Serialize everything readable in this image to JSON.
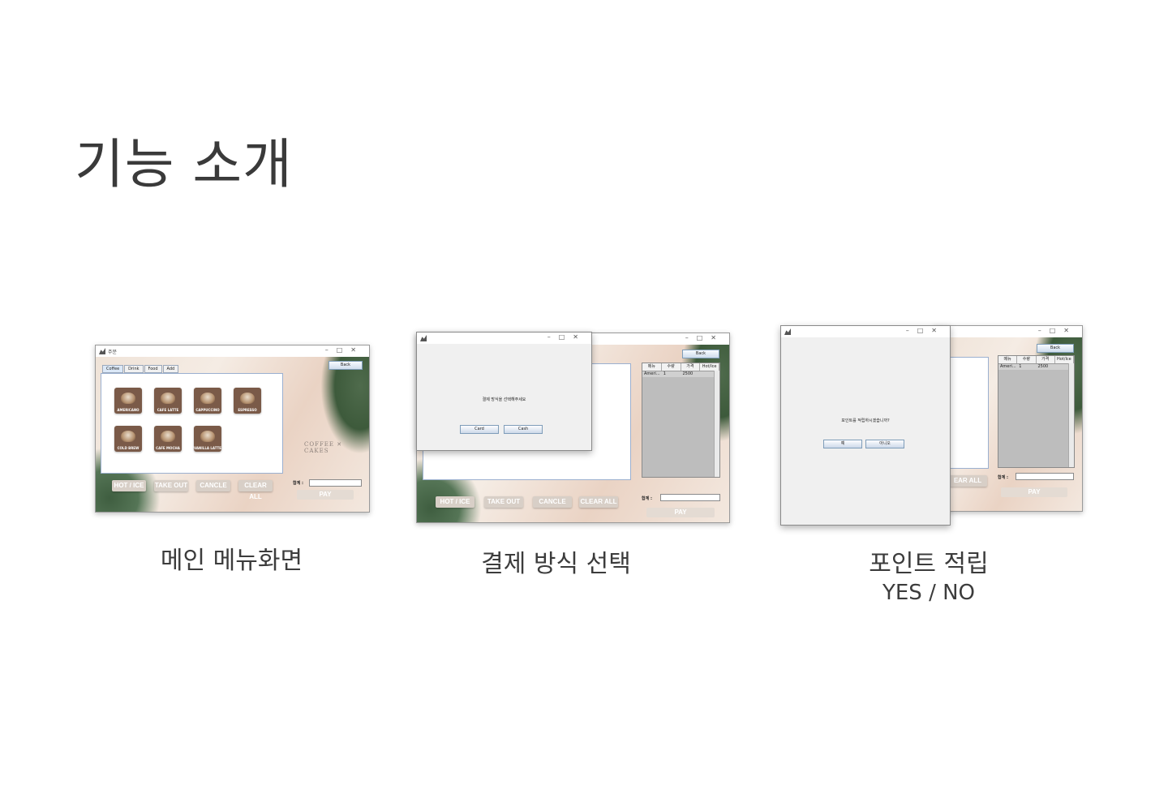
{
  "slide": {
    "title": "기능 소개"
  },
  "screens": [
    {
      "caption": "메인 메뉴화면",
      "window_title": "주문",
      "tabs": [
        "Coffee",
        "Drink",
        "Food",
        "Add"
      ],
      "back_label": "Back",
      "products": [
        "AMERICANO",
        "CAFE LATTE",
        "CAPPUCCINO",
        "ESPRESSO",
        "COLD BREW",
        "CAFE MOCHA",
        "VANILLA LATTE"
      ],
      "actions": [
        "HOT / ICE",
        "TAKE OUT",
        "CANCLE",
        "CLEAR ALL"
      ],
      "sum_label": "합계 :",
      "pay_label": "PAY",
      "logo": "COFFEE ✕ CAKES"
    },
    {
      "caption": "결제 방식 선택",
      "back_label": "Back",
      "table_headers": [
        "메뉴",
        "수량",
        "가격",
        "Hot/Ice"
      ],
      "table_row": [
        "Ameri...",
        "1",
        "2500",
        ""
      ],
      "actions": [
        "HOT / ICE",
        "TAKE OUT",
        "CANCLE",
        "CLEAR ALL"
      ],
      "sum_label": "합계 :",
      "pay_label": "PAY",
      "dialog_message": "결제 방식을 선택해주세요",
      "dialog_buttons": [
        "Card",
        "Cash"
      ]
    },
    {
      "caption": "포인트 적립",
      "caption_sub": "YES / NO",
      "back_label": "Back",
      "table_headers": [
        "메뉴",
        "수량",
        "가격",
        "Hot/Ice"
      ],
      "table_row": [
        "Ameri...",
        "1",
        "2500",
        ""
      ],
      "partial_action": "EAR ALL",
      "sum_label": "합계 :",
      "pay_label": "PAY",
      "dialog_message": "포인트를 적립하시겠습니까?",
      "dialog_buttons": [
        "예",
        "아니오"
      ]
    }
  ]
}
